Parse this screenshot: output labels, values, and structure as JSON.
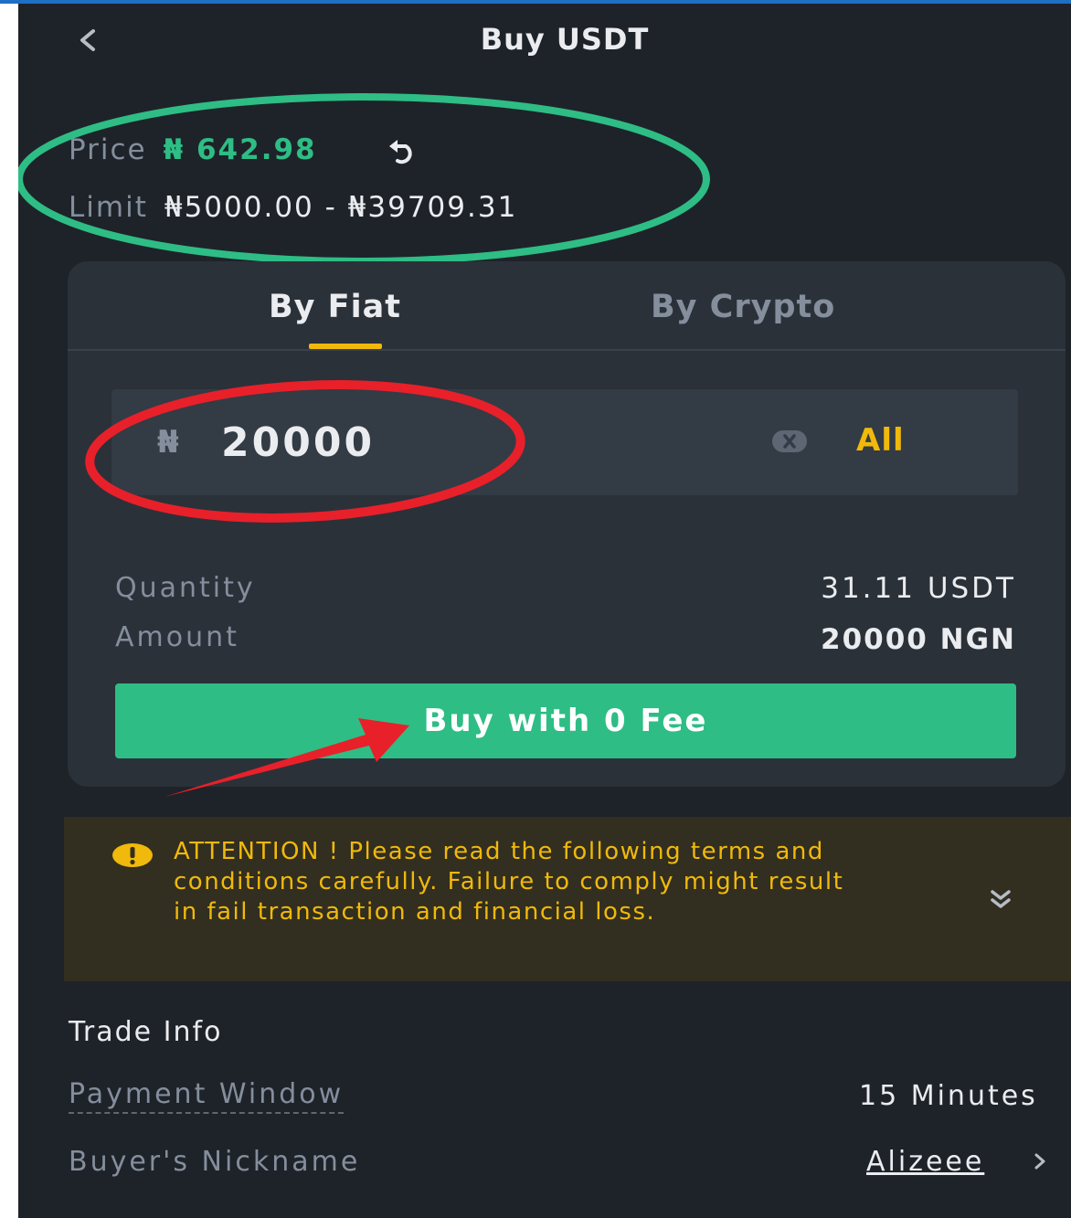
{
  "header": {
    "title": "Buy USDT",
    "back_icon": "chevron-left-icon"
  },
  "price_info": {
    "price_label": "Price",
    "price_value": "₦ 642.98",
    "limit_label": "Limit",
    "limit_value": "₦5000.00 - ₦39709.31"
  },
  "tabs": [
    {
      "label": "By Fiat",
      "active": true
    },
    {
      "label": "By Crypto",
      "active": false
    }
  ],
  "amount_input": {
    "currency_symbol": "₦",
    "value": "20000",
    "all_label": "All"
  },
  "summary": {
    "quantity_label": "Quantity",
    "quantity_value": "31.11 USDT",
    "amount_label": "Amount",
    "amount_value": "20000 NGN"
  },
  "buy_button": {
    "label": "Buy with 0 Fee"
  },
  "attention": {
    "text": "ATTENTION ! Please read the following terms and conditions carefully. Failure to comply might result in fail transaction and financial loss."
  },
  "trade_info": {
    "heading": "Trade Info",
    "payment_window_label": "Payment Window",
    "payment_window_value": "15 Minutes",
    "buyer_nickname_label": "Buyer's Nickname",
    "buyer_nickname_value": "Alizeee"
  },
  "colors": {
    "background": "#1e2329",
    "card": "#2b3139",
    "accent_yellow": "#f0b90b",
    "buy_green": "#2ebd85",
    "muted_text": "#848e9c",
    "annotation_green": "#2ebd85",
    "annotation_red": "#e8202a"
  }
}
